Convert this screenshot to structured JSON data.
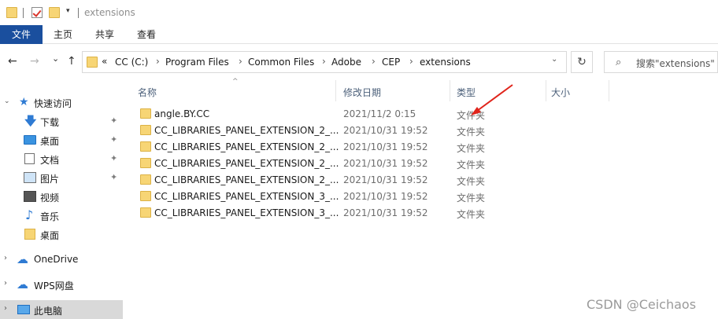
{
  "titlebar": {
    "title": "extensions",
    "dropdown_glyph": "▾"
  },
  "ribbon": {
    "tabs": [
      "文件",
      "主页",
      "共享",
      "查看"
    ]
  },
  "address": {
    "prefix": "«",
    "crumbs": [
      "CC (C:)",
      "Program Files",
      "Common Files",
      "Adobe",
      "CEP",
      "extensions"
    ],
    "separator": "›",
    "dropdown": "⌄",
    "refresh": "↻"
  },
  "search": {
    "placeholder": "搜索\"extensions\"",
    "icon": "⌕"
  },
  "nav": {
    "back": "←",
    "forward": "→",
    "recent": "⌄",
    "up": "↑"
  },
  "sidebar": {
    "quick_access": "快速访问",
    "items": [
      {
        "label": "下载",
        "icon": "download-icon",
        "pinned": true
      },
      {
        "label": "桌面",
        "icon": "desktop-icon",
        "pinned": true
      },
      {
        "label": "文档",
        "icon": "document-icon",
        "pinned": true
      },
      {
        "label": "图片",
        "icon": "pictures-icon",
        "pinned": true
      },
      {
        "label": "视频",
        "icon": "video-icon",
        "pinned": false
      },
      {
        "label": "音乐",
        "icon": "music-icon",
        "pinned": false
      },
      {
        "label": "桌面",
        "icon": "folder-icon",
        "pinned": false
      }
    ],
    "onedrive": "OneDrive",
    "wps": "WPS网盘",
    "thispc": "此电脑",
    "pin_glyph": "📌"
  },
  "columns": {
    "name": "名称",
    "modified": "修改日期",
    "type": "类型",
    "size": "大小",
    "sort_glyph": "^"
  },
  "files": [
    {
      "name": "angle.BY.CC",
      "modified": "2021/11/2 0:15",
      "type": "文件夹"
    },
    {
      "name": "CC_LIBRARIES_PANEL_EXTENSION_2_...",
      "modified": "2021/10/31 19:52",
      "type": "文件夹"
    },
    {
      "name": "CC_LIBRARIES_PANEL_EXTENSION_2_...",
      "modified": "2021/10/31 19:52",
      "type": "文件夹"
    },
    {
      "name": "CC_LIBRARIES_PANEL_EXTENSION_2_...",
      "modified": "2021/10/31 19:52",
      "type": "文件夹"
    },
    {
      "name": "CC_LIBRARIES_PANEL_EXTENSION_2_...",
      "modified": "2021/10/31 19:52",
      "type": "文件夹"
    },
    {
      "name": "CC_LIBRARIES_PANEL_EXTENSION_3_...",
      "modified": "2021/10/31 19:52",
      "type": "文件夹"
    },
    {
      "name": "CC_LIBRARIES_PANEL_EXTENSION_3_...",
      "modified": "2021/10/31 19:52",
      "type": "文件夹"
    }
  ],
  "watermark": "CSDN @Ceichaos",
  "colors": {
    "file_tab": "#1a4f9e",
    "annotation_arrow": "#e0241b",
    "folder": "#f7d575"
  }
}
